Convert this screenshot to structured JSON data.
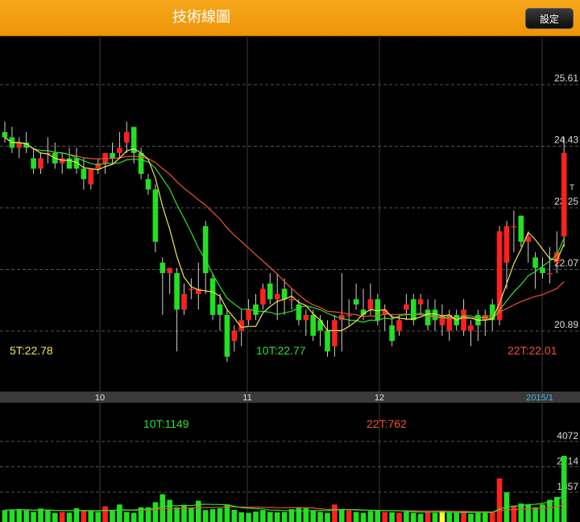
{
  "header": {
    "title": "技術線圖",
    "settings_label": "設定"
  },
  "chart_data": [
    {
      "type": "candlestick",
      "price_ticks": [
        "25.61",
        "24.43",
        "23.25",
        "22.07",
        "20.89"
      ],
      "price_tick_values": [
        25.61,
        24.43,
        23.25,
        22.07,
        20.89
      ],
      "extra_tick": "T",
      "x_labels": [
        "10",
        "11",
        "12",
        "2015/1"
      ],
      "ma_labels": {
        "ma5": "5T:22.78",
        "ma10": "10T:22.77",
        "ma22": "22T:22.01"
      },
      "colors": {
        "up": "#ff2020",
        "down": "#22e022",
        "ma5": "#f2e850",
        "ma10": "#30e030",
        "ma22": "#ee5533",
        "grid": "#555555",
        "axis_text": "#cccccc"
      },
      "candles": [
        [
          24.7,
          24.9,
          24.5,
          24.6
        ],
        [
          24.6,
          24.8,
          24.3,
          24.4
        ],
        [
          24.4,
          24.6,
          24.2,
          24.5
        ],
        [
          24.5,
          24.7,
          24.3,
          24.4
        ],
        [
          24.2,
          24.4,
          23.9,
          24.0
        ],
        [
          24.0,
          24.3,
          23.9,
          24.2
        ],
        [
          24.3,
          24.6,
          24.1,
          24.3
        ],
        [
          24.3,
          24.5,
          24.0,
          24.1
        ],
        [
          24.1,
          24.3,
          23.9,
          24.2
        ],
        [
          24.2,
          24.4,
          24.0,
          24.0
        ],
        [
          24.2,
          24.4,
          23.9,
          24.0
        ],
        [
          24.0,
          24.2,
          23.6,
          23.8
        ],
        [
          23.7,
          24.0,
          23.6,
          24.0
        ],
        [
          24.0,
          24.2,
          23.9,
          24.1
        ],
        [
          24.1,
          24.3,
          23.9,
          24.3
        ],
        [
          24.3,
          24.5,
          24.1,
          24.2
        ],
        [
          24.3,
          24.7,
          24.2,
          24.4
        ],
        [
          24.5,
          24.9,
          24.3,
          24.7
        ],
        [
          24.8,
          24.8,
          24.1,
          24.3
        ],
        [
          24.3,
          24.4,
          23.8,
          23.9
        ],
        [
          23.8,
          23.9,
          23.5,
          23.6
        ],
        [
          23.6,
          23.7,
          22.4,
          22.6
        ],
        [
          22.2,
          22.3,
          21.2,
          22.0
        ],
        [
          22.0,
          22.1,
          21.6,
          22.1
        ],
        [
          22.0,
          22.1,
          20.5,
          21.3
        ],
        [
          21.3,
          21.8,
          21.2,
          21.6
        ],
        [
          21.7,
          21.9,
          21.5,
          21.7
        ],
        [
          21.6,
          22.2,
          21.3,
          21.7
        ],
        [
          22.9,
          23.0,
          21.6,
          22.0
        ],
        [
          21.9,
          22.0,
          21.1,
          21.2
        ],
        [
          21.4,
          21.6,
          20.9,
          21.2
        ],
        [
          21.2,
          21.3,
          20.3,
          20.4
        ],
        [
          20.7,
          21.0,
          20.5,
          20.9
        ],
        [
          20.9,
          21.3,
          20.6,
          21.1
        ],
        [
          21.1,
          21.5,
          21.0,
          21.3
        ],
        [
          21.4,
          21.6,
          21.1,
          21.2
        ],
        [
          21.4,
          21.8,
          21.3,
          21.7
        ],
        [
          21.8,
          22.0,
          21.4,
          21.5
        ],
        [
          21.5,
          22.0,
          21.1,
          21.6
        ],
        [
          21.7,
          21.9,
          21.2,
          21.5
        ],
        [
          21.5,
          21.7,
          21.3,
          21.5
        ],
        [
          21.4,
          21.5,
          21.0,
          21.1
        ],
        [
          21.1,
          21.3,
          20.8,
          21.2
        ],
        [
          21.2,
          21.3,
          20.7,
          20.8
        ],
        [
          21.1,
          21.2,
          20.6,
          20.9
        ],
        [
          20.9,
          21.1,
          20.4,
          20.5
        ],
        [
          20.6,
          21.2,
          20.4,
          21.1
        ],
        [
          21.1,
          22.0,
          20.5,
          21.2
        ],
        [
          21.2,
          21.5,
          21.0,
          21.2
        ],
        [
          21.5,
          21.8,
          21.3,
          21.4
        ],
        [
          21.3,
          21.7,
          21.1,
          21.2
        ],
        [
          21.3,
          21.8,
          21.2,
          21.5
        ],
        [
          21.5,
          21.6,
          21.0,
          21.1
        ],
        [
          21.2,
          21.4,
          20.9,
          21.3
        ],
        [
          21.0,
          21.2,
          20.6,
          20.7
        ],
        [
          20.9,
          21.2,
          20.8,
          21.1
        ],
        [
          21.3,
          21.6,
          21.1,
          21.4
        ],
        [
          21.5,
          21.6,
          21.0,
          21.1
        ],
        [
          21.4,
          21.6,
          21.2,
          21.5
        ],
        [
          21.3,
          21.5,
          20.9,
          21.0
        ],
        [
          21.3,
          21.5,
          20.9,
          21.1
        ],
        [
          21.0,
          21.4,
          20.8,
          21.2
        ],
        [
          20.9,
          21.3,
          20.7,
          21.2
        ],
        [
          21.2,
          21.3,
          20.9,
          21.0
        ],
        [
          20.9,
          21.5,
          20.8,
          21.3
        ],
        [
          20.9,
          21.1,
          20.6,
          21.0
        ],
        [
          21.2,
          21.3,
          20.7,
          21.0
        ],
        [
          21.1,
          21.3,
          20.8,
          21.2
        ],
        [
          21.4,
          21.5,
          20.9,
          21.1
        ],
        [
          21.1,
          22.9,
          21.0,
          22.8
        ],
        [
          22.2,
          23.0,
          21.7,
          22.9
        ],
        [
          22.9,
          23.2,
          22.4,
          22.9
        ],
        [
          23.1,
          23.1,
          22.5,
          22.6
        ],
        [
          22.6,
          22.8,
          22.2,
          22.7
        ],
        [
          22.3,
          22.4,
          21.7,
          22.1
        ],
        [
          22.1,
          22.3,
          21.9,
          22.0
        ],
        [
          22.0,
          22.5,
          21.8,
          22.0
        ],
        [
          22.2,
          22.8,
          22.0,
          22.4
        ],
        [
          22.7,
          24.6,
          22.5,
          24.3
        ]
      ]
    },
    {
      "type": "volume_bar",
      "volume_ticks": [
        "4072",
        "2714",
        "1357"
      ],
      "volume_tick_values": [
        4072,
        2714,
        1357
      ],
      "ma_labels": {
        "ma10": "10T:1149",
        "ma22": "22T:762"
      },
      "colors": {
        "up": "#ff2020",
        "down": "#22e022",
        "flat": "#ffff30",
        "ma10": "#30e030",
        "ma22": "#ee5533"
      },
      "volumes": [
        [
          400,
          "d"
        ],
        [
          420,
          "d"
        ],
        [
          450,
          "d"
        ],
        [
          380,
          "d"
        ],
        [
          300,
          "d"
        ],
        [
          480,
          "d"
        ],
        [
          400,
          "d"
        ],
        [
          250,
          "d"
        ],
        [
          300,
          "u"
        ],
        [
          260,
          "d"
        ],
        [
          500,
          "d"
        ],
        [
          400,
          "u"
        ],
        [
          350,
          "d"
        ],
        [
          300,
          "d"
        ],
        [
          600,
          "u"
        ],
        [
          380,
          "d"
        ],
        [
          700,
          "d"
        ],
        [
          300,
          "d"
        ],
        [
          250,
          "d"
        ],
        [
          550,
          "d"
        ],
        [
          550,
          "d"
        ],
        [
          820,
          "d"
        ],
        [
          1250,
          "d"
        ],
        [
          950,
          "d"
        ],
        [
          550,
          "d"
        ],
        [
          650,
          "d"
        ],
        [
          500,
          "d"
        ],
        [
          900,
          "d"
        ],
        [
          400,
          "d"
        ],
        [
          450,
          "d"
        ],
        [
          500,
          "d"
        ],
        [
          700,
          "d"
        ],
        [
          420,
          "d"
        ],
        [
          280,
          "d"
        ],
        [
          250,
          "d"
        ],
        [
          320,
          "d"
        ],
        [
          400,
          "d"
        ],
        [
          300,
          "d"
        ],
        [
          280,
          "d"
        ],
        [
          300,
          "d"
        ],
        [
          450,
          "d"
        ],
        [
          550,
          "d"
        ],
        [
          500,
          "d"
        ],
        [
          380,
          "d"
        ],
        [
          300,
          "d"
        ],
        [
          250,
          "d"
        ],
        [
          700,
          "u"
        ],
        [
          450,
          "d"
        ],
        [
          380,
          "u"
        ],
        [
          300,
          "d"
        ],
        [
          250,
          "d"
        ],
        [
          350,
          "d"
        ],
        [
          400,
          "d"
        ],
        [
          300,
          "u"
        ],
        [
          280,
          "d"
        ],
        [
          260,
          "u"
        ],
        [
          300,
          "d"
        ],
        [
          250,
          "d"
        ],
        [
          200,
          "d"
        ],
        [
          300,
          "u"
        ],
        [
          250,
          "d"
        ],
        [
          350,
          "f"
        ],
        [
          300,
          "d"
        ],
        [
          250,
          "d"
        ],
        [
          350,
          "u"
        ],
        [
          200,
          "d"
        ],
        [
          250,
          "d"
        ],
        [
          250,
          "d"
        ],
        [
          300,
          "u"
        ],
        [
          2100,
          "u"
        ],
        [
          1350,
          "d"
        ],
        [
          650,
          "u"
        ],
        [
          750,
          "d"
        ],
        [
          700,
          "d"
        ],
        [
          550,
          "d"
        ],
        [
          700,
          "d"
        ],
        [
          950,
          "d"
        ],
        [
          1100,
          "d"
        ],
        [
          3300,
          "d"
        ]
      ]
    }
  ]
}
